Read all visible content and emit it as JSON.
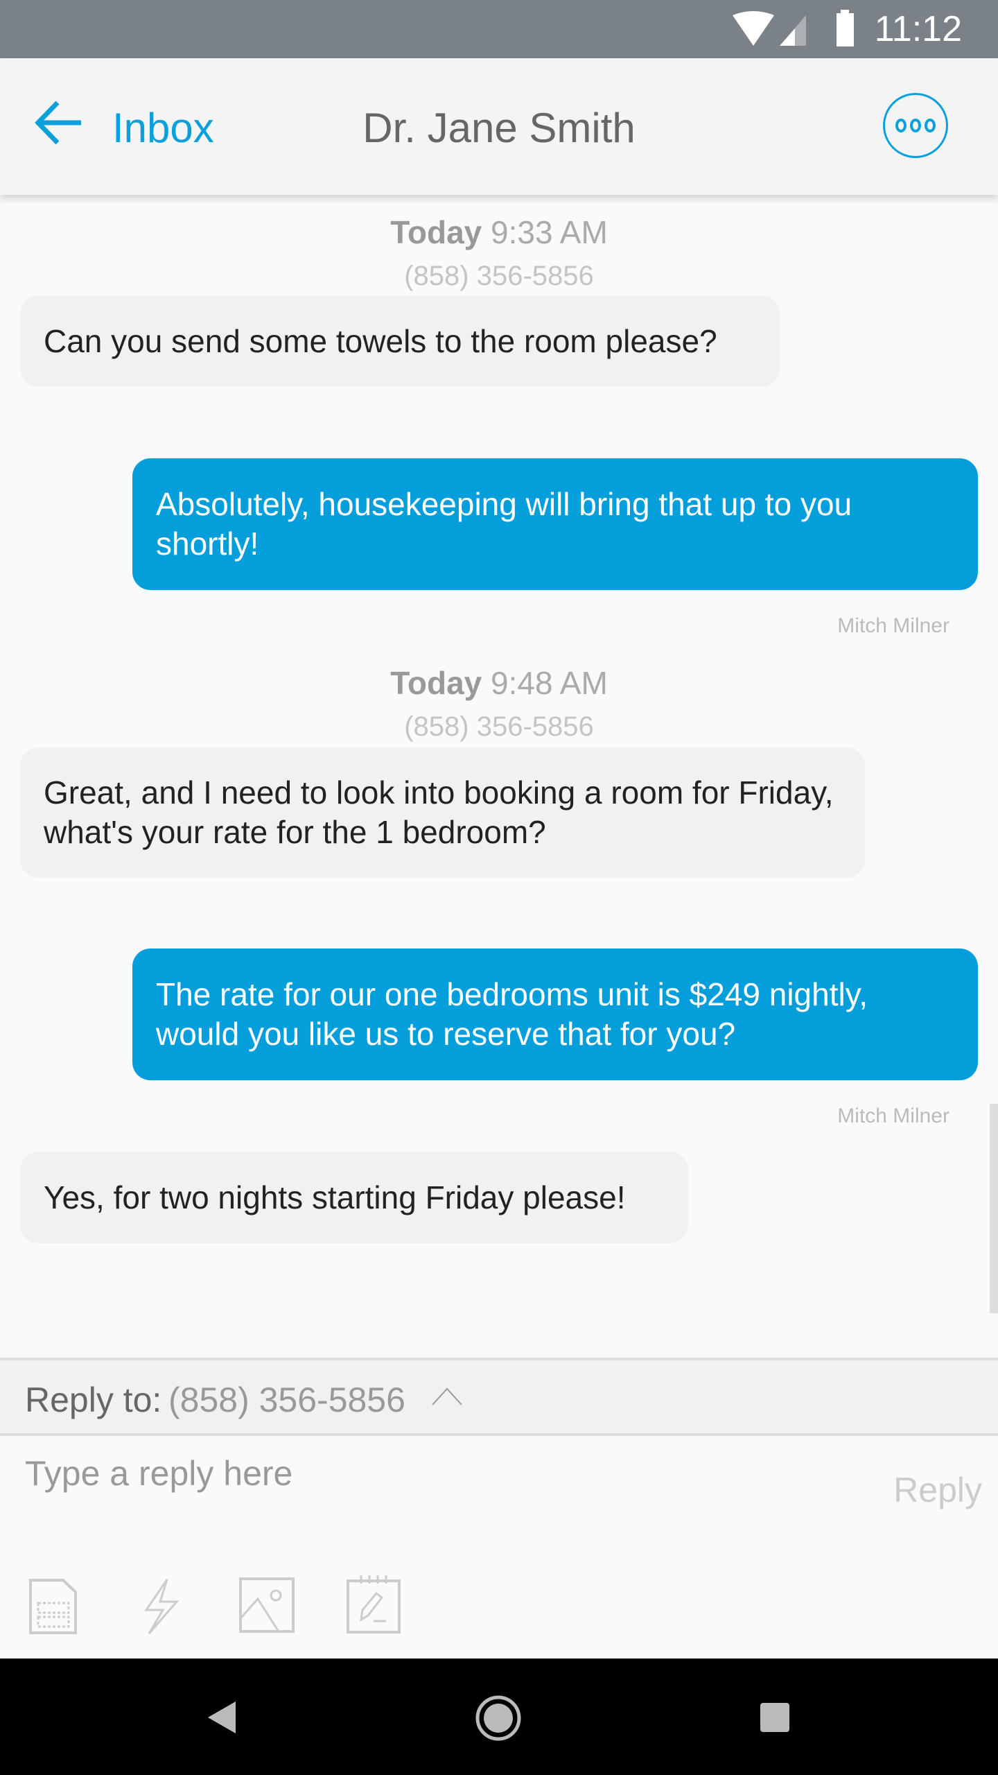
{
  "status_bar": {
    "time": "11:12",
    "icons": [
      "wifi-icon",
      "signal-icon",
      "battery-icon"
    ]
  },
  "header": {
    "back_label": "Inbox",
    "title": "Dr. Jane Smith",
    "menu_icon": "more-horizontal-icon"
  },
  "colors": {
    "accent": "#049fdb",
    "status_bar": "#7a8288"
  },
  "conversation": [
    {
      "type": "timestamp",
      "day": "Today",
      "time": "9:33 AM",
      "phone": "(858) 356-5856"
    },
    {
      "type": "incoming",
      "text": "Can you send some towels to the room please?"
    },
    {
      "type": "outgoing",
      "text": "Absolutely, housekeeping will bring that up to you shortly!",
      "sender": "Mitch Milner"
    },
    {
      "type": "timestamp",
      "day": "Today",
      "time": "9:48 AM",
      "phone": "(858) 356-5856"
    },
    {
      "type": "incoming",
      "text": "Great, and I need to look into booking a room for Friday, what's your rate for the 1 bedroom?"
    },
    {
      "type": "outgoing",
      "text": "The rate for our one bedrooms unit is $249 nightly, would you like us to reserve that for you?",
      "sender": "Mitch Milner"
    },
    {
      "type": "incoming",
      "text": "Yes, for two nights starting Friday please!"
    }
  ],
  "reply_bar": {
    "label": "Reply to:",
    "number": "(858) 356-5856"
  },
  "composer": {
    "placeholder": "Type a reply here",
    "reply_label": "Reply",
    "tools": [
      "template-icon",
      "lightning-icon",
      "image-icon",
      "notepad-icon"
    ]
  }
}
